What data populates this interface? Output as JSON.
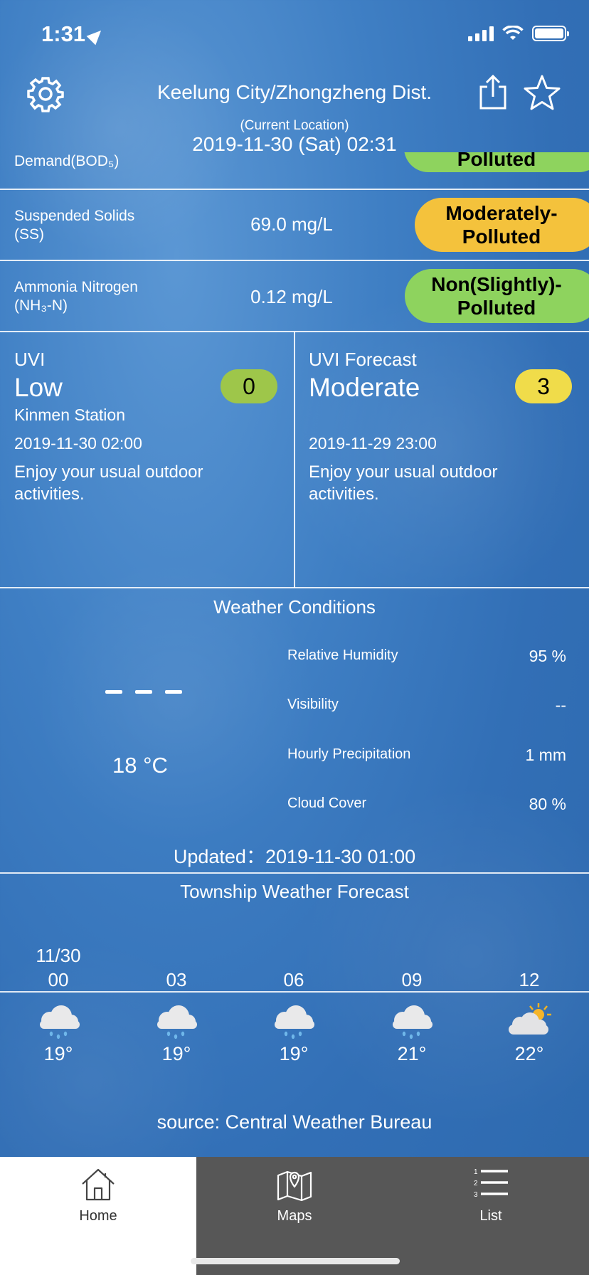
{
  "status_bar": {
    "time": "1:31"
  },
  "header": {
    "title": "Keelung City/Zhongzheng Dist.",
    "subtitle": "(Current Location)",
    "datetime": "2019-11-30 (Sat) 02:31"
  },
  "water_quality": {
    "partial_row": {
      "name": "Demand(BOD₅)",
      "status": "Polluted"
    },
    "rows": [
      {
        "name_line1": "Suspended Solids",
        "name_line2": "(SS)",
        "value": "69.0 mg/L",
        "status_line1": "Moderately-",
        "status_line2": "Polluted"
      },
      {
        "name_line1": "Ammonia Nitrogen",
        "name_line2": "(NH₃-N)",
        "value": "0.12 mg/L",
        "status_line1": "Non(Slightly)-",
        "status_line2": "Polluted"
      }
    ]
  },
  "uvi": {
    "label": "UVI",
    "level": "Low",
    "index": "0",
    "station": "Kinmen Station",
    "time": "2019-11-30 02:00",
    "advice": "Enjoy your usual outdoor activities."
  },
  "uvi_forecast": {
    "label": "UVI Forecast",
    "level": "Moderate",
    "index": "3",
    "time": "2019-11-29 23:00",
    "advice": "Enjoy your usual outdoor activities."
  },
  "weather": {
    "title": "Weather Conditions",
    "temperature": "18 °C",
    "conditions": [
      {
        "label": "Relative Humidity",
        "value": "95 %"
      },
      {
        "label": "Visibility",
        "value": "--"
      },
      {
        "label": "Hourly Precipitation",
        "value": "1 mm"
      },
      {
        "label": "Cloud Cover",
        "value": "80 %"
      }
    ],
    "updated": "Updated：2019-11-30 01:00"
  },
  "forecast": {
    "title": "Township Weather Forecast",
    "date": "11/30",
    "items": [
      {
        "hour": "00",
        "temp": "19°",
        "icon": "rain-cloud-icon"
      },
      {
        "hour": "03",
        "temp": "19°",
        "icon": "rain-cloud-icon"
      },
      {
        "hour": "06",
        "temp": "19°",
        "icon": "rain-cloud-icon"
      },
      {
        "hour": "09",
        "temp": "21°",
        "icon": "rain-cloud-icon"
      },
      {
        "hour": "12",
        "temp": "22°",
        "icon": "cloud-sun-icon"
      }
    ],
    "source": "source: Central Weather Bureau"
  },
  "tabs": [
    {
      "label": "Home",
      "icon": "home-icon",
      "active": true
    },
    {
      "label": "Maps",
      "icon": "map-icon",
      "active": false
    },
    {
      "label": "List",
      "icon": "list-icon",
      "active": false
    }
  ],
  "colors": {
    "background": "#3f7fc4",
    "pill_green": "#8ed35e",
    "pill_yellow": "#f4c23c",
    "uvi_low": "#9ec64a",
    "uvi_moderate": "#f0dc4a",
    "tab_active_bg": "#ffffff",
    "tab_inactive_bg": "#575757"
  }
}
